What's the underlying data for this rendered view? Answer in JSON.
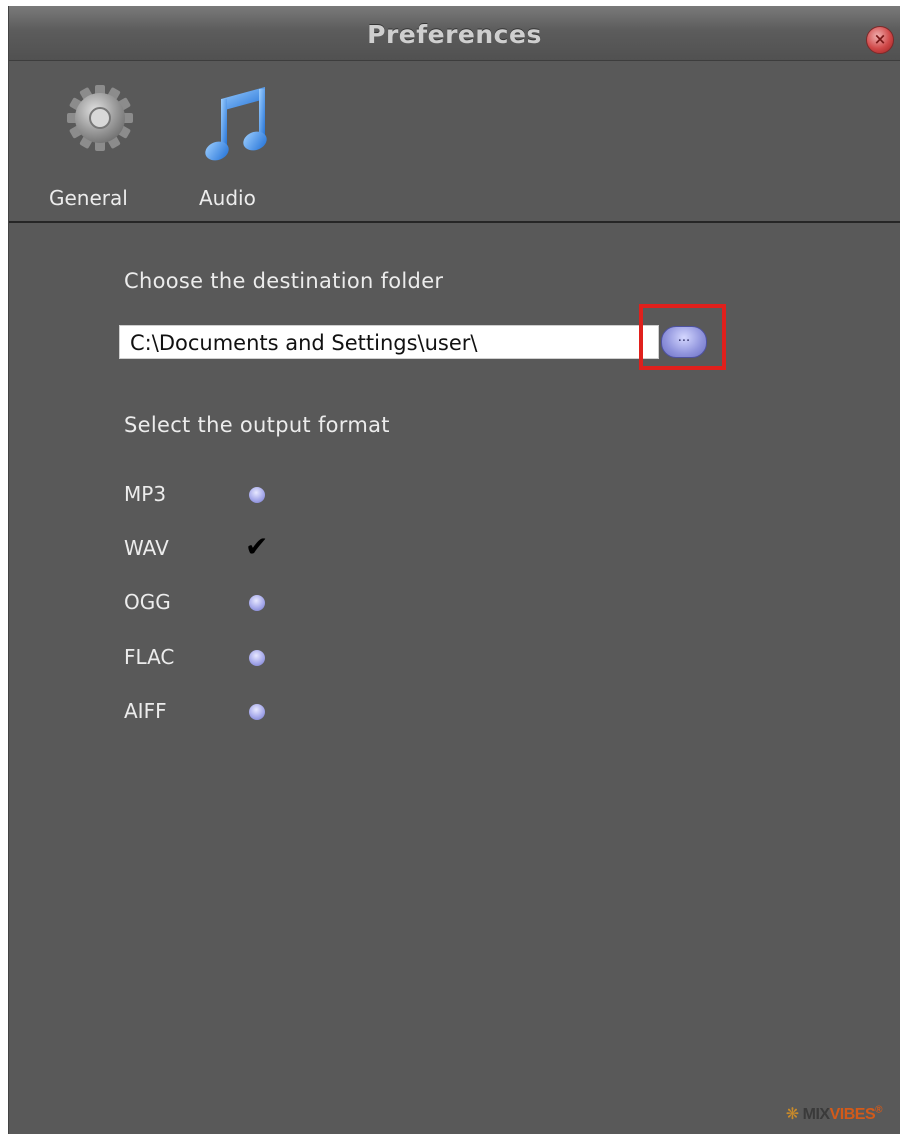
{
  "window": {
    "title": "Preferences",
    "close_glyph": "×"
  },
  "toolbar": {
    "items": [
      {
        "label": "General",
        "icon": "gear-icon",
        "color": "#9a9a9a"
      },
      {
        "label": "Audio",
        "icon": "music-note-icon",
        "color": "#2f7fe0"
      }
    ]
  },
  "destination": {
    "label": "Choose the destination folder",
    "path_value": "C:\\Documents and Settings\\user\\",
    "browse_label": "...",
    "highlight_color": "#e0201c"
  },
  "output": {
    "label": "Select the output format",
    "formats": [
      {
        "label": "MP3",
        "selected": false
      },
      {
        "label": "WAV",
        "selected": true,
        "mark": "✔"
      },
      {
        "label": "OGG",
        "selected": false
      },
      {
        "label": "FLAC",
        "selected": false
      },
      {
        "label": "AIFF",
        "selected": false
      }
    ]
  },
  "brand": {
    "part1": "MIX",
    "part2": "VIBES",
    "trademark": "®"
  }
}
